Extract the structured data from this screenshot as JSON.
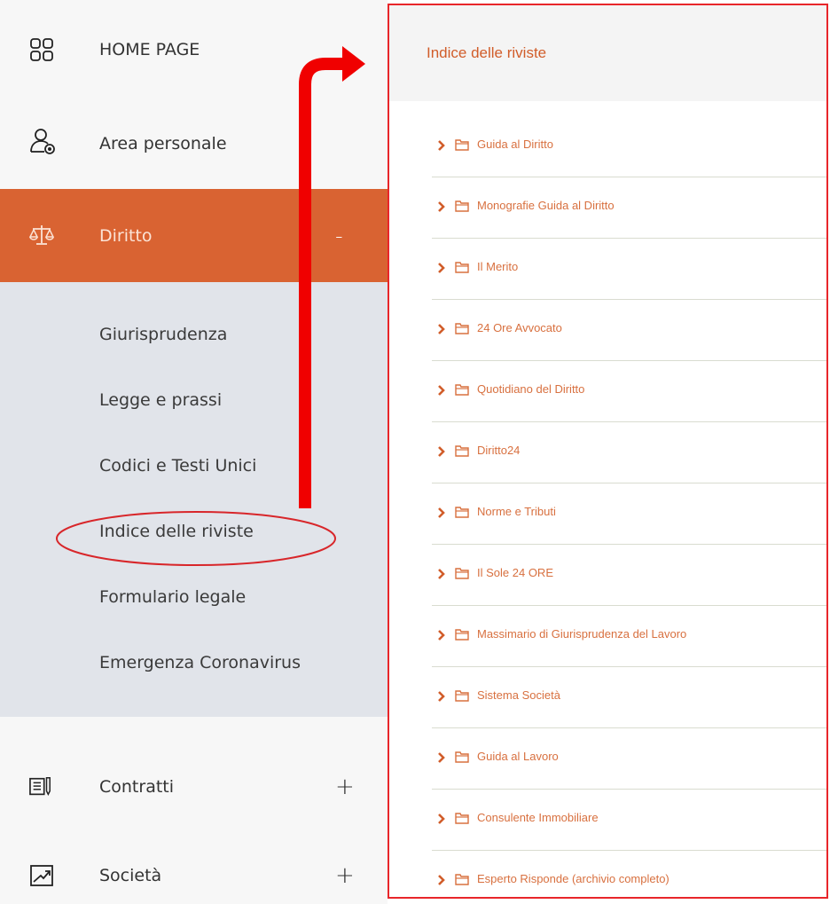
{
  "sidebar": {
    "items": [
      {
        "label": "HOME PAGE",
        "icon": "grid-icon"
      },
      {
        "label": "Area personale",
        "icon": "user-icon"
      },
      {
        "label": "Diritto",
        "icon": "scales-icon",
        "toggle": "-",
        "active": true,
        "sub_items": [
          "Giurisprudenza",
          "Legge e prassi",
          "Codici e Testi Unici",
          "Indice delle riviste",
          "Formulario legale",
          "Emergenza Coronavirus"
        ]
      },
      {
        "label": "Contratti",
        "icon": "document-pen-icon",
        "toggle": "+"
      },
      {
        "label": "Società",
        "icon": "trend-chart-icon",
        "toggle": "+"
      }
    ]
  },
  "panel": {
    "title": "Indice delle riviste",
    "items": [
      "Guida al Diritto",
      "Monografie Guida al Diritto",
      "Il Merito",
      "24 Ore Avvocato",
      "Quotidiano del Diritto",
      "Diritto24",
      "Norme e Tributi",
      "Il Sole 24 ORE",
      "Massimario di Giurisprudenza del Lavoro",
      "Sistema Società",
      "Guida al Lavoro",
      "Consulente Immobiliare",
      "Esperto Risponde (archivio completo)"
    ]
  },
  "colors": {
    "accent": "#d96332",
    "panel_text": "#d8703f",
    "submenu_bg": "#e1e4ea",
    "annotation_red": "#e8262a"
  }
}
